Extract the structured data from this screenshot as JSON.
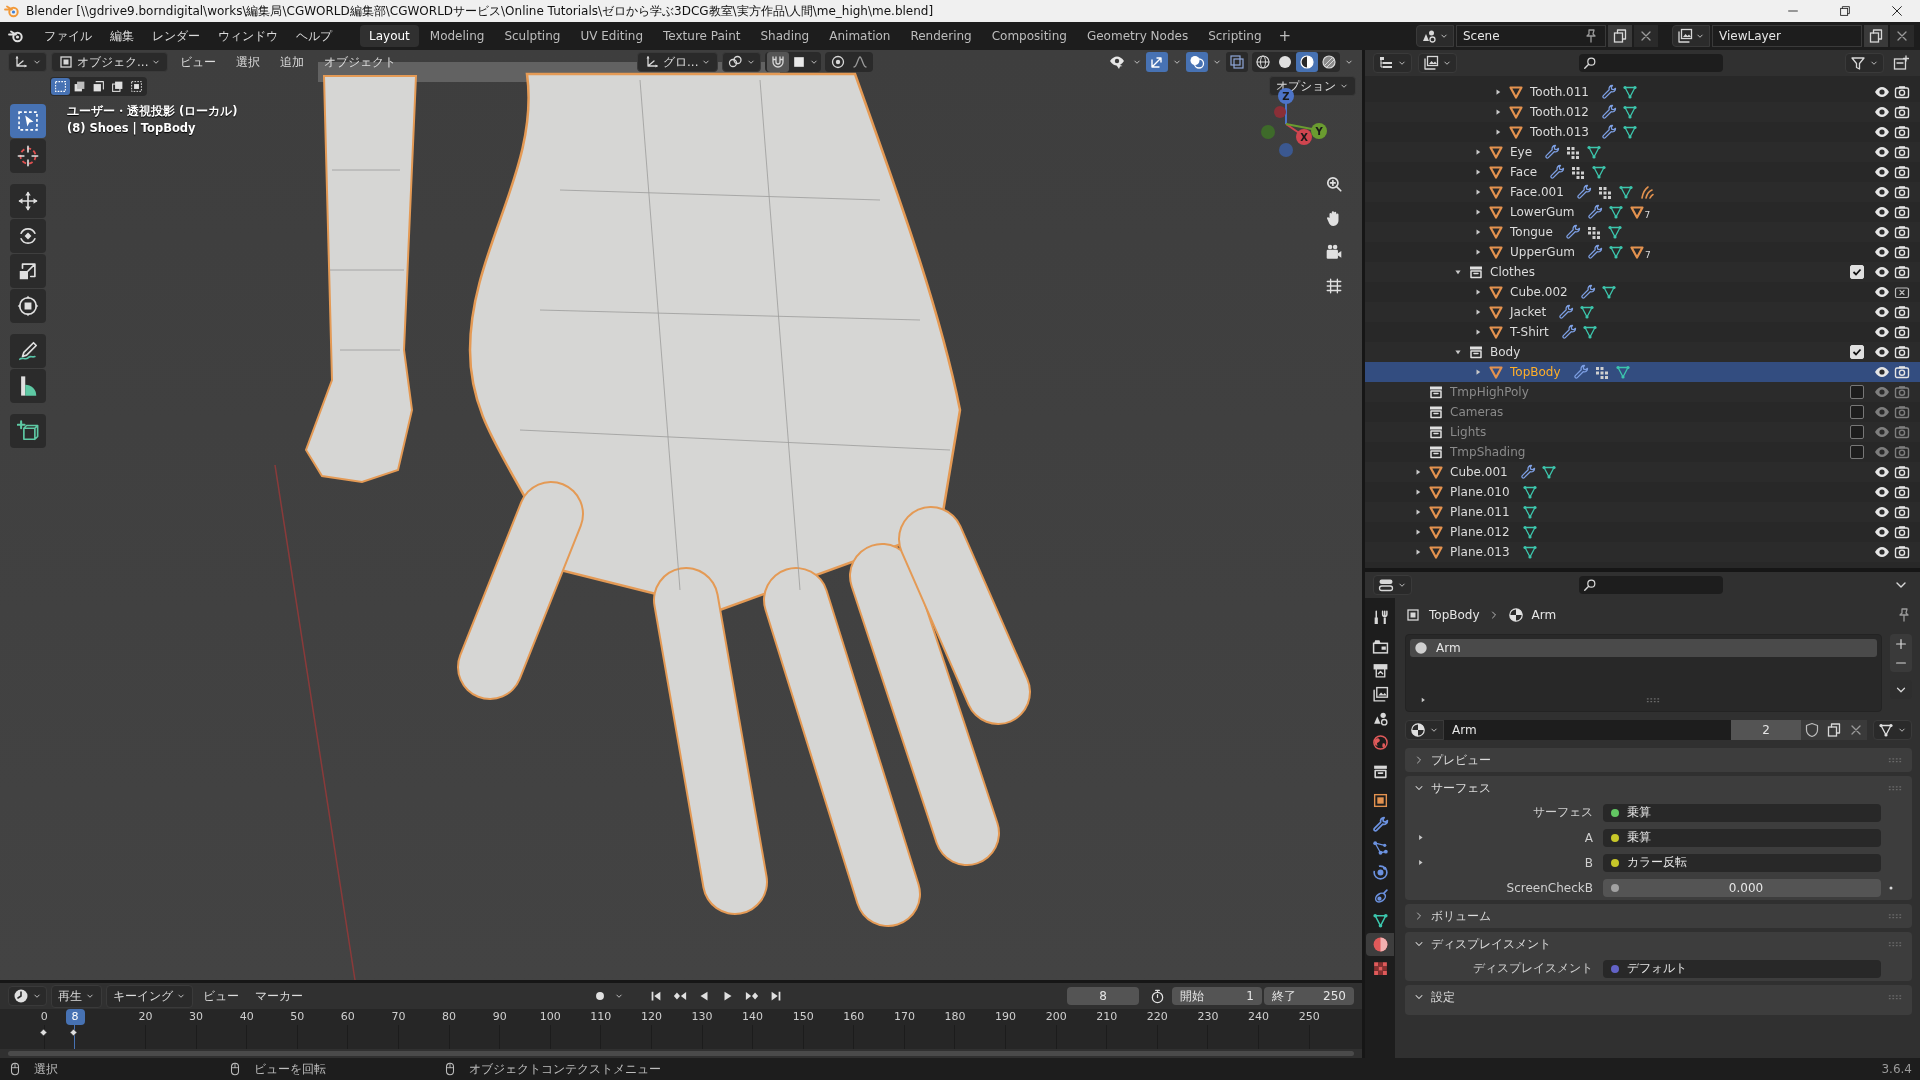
{
  "window": {
    "title": "Blender [\\\\gdrive9.borndigital\\works\\編集局\\CGWORLD編集部\\CGWORLDサービス\\Online Tutorials\\ゼロから学ぶ3DCG教室\\実方作品\\人間\\me_high\\me.blend]"
  },
  "menu": [
    "ファイル",
    "編集",
    "レンダー",
    "ウィンドウ",
    "ヘルプ"
  ],
  "workspaces": [
    {
      "label": "Layout",
      "selected": true
    },
    {
      "label": "Modeling",
      "selected": false
    },
    {
      "label": "Sculpting",
      "selected": false
    },
    {
      "label": "UV Editing",
      "selected": false
    },
    {
      "label": "Texture Paint",
      "selected": false
    },
    {
      "label": "Shading",
      "selected": false
    },
    {
      "label": "Animation",
      "selected": false
    },
    {
      "label": "Rendering",
      "selected": false
    },
    {
      "label": "Compositing",
      "selected": false
    },
    {
      "label": "Geometry Nodes",
      "selected": false
    },
    {
      "label": "Scripting",
      "selected": false
    }
  ],
  "add_workspace": "+",
  "scene": "Scene",
  "view_layer": "ViewLayer",
  "viewport": {
    "mode": "オブジェク...",
    "menus": [
      "ビュー",
      "選択",
      "追加",
      "オブジェクト"
    ],
    "orientation": "グロ...",
    "select_modes": [
      {
        "kind": "set",
        "selected": true
      },
      {
        "kind": "extend",
        "selected": false
      },
      {
        "kind": "subtract",
        "selected": false
      },
      {
        "kind": "invert",
        "selected": false
      },
      {
        "kind": "intersect",
        "selected": false
      }
    ],
    "shading": [
      {
        "kind": "wireframe",
        "selected": false
      },
      {
        "kind": "solid",
        "selected": false
      },
      {
        "kind": "material",
        "selected": true
      },
      {
        "kind": "rendered",
        "selected": false
      }
    ],
    "options": "オプション",
    "view_name": "ユーザー・透視投影 (ローカル)",
    "context": "(8) Shoes | TopBody",
    "tools": [
      {
        "kind": "select",
        "selected": true
      },
      {
        "kind": "cursor",
        "selected": false
      },
      {
        "kind": "move",
        "selected": false
      },
      {
        "kind": "rotate",
        "selected": false
      },
      {
        "kind": "scale",
        "selected": false
      },
      {
        "kind": "transform",
        "selected": false
      },
      {
        "kind": "annotate",
        "selected": false
      },
      {
        "kind": "measure",
        "selected": false
      },
      {
        "kind": "add_cube",
        "selected": false
      }
    ],
    "gizmo": {
      "z": "Z",
      "x": "X",
      "y": "Y"
    }
  },
  "outliner": {
    "tree": [
      {
        "children": [
          {
            "children": [
              {
                "children": [
                  {
                    "children": [
                      {
                        "name": "Tooth.011",
                        "kind": "object",
                        "expanded": false,
                        "selected": false,
                        "badges": [
                          {
                            "kind": "modifier"
                          },
                          {
                            "kind": "mesh"
                          }
                        ]
                      },
                      {
                        "name": "Tooth.012",
                        "kind": "object",
                        "expanded": false,
                        "selected": false,
                        "badges": [
                          {
                            "kind": "modifier"
                          },
                          {
                            "kind": "mesh"
                          }
                        ]
                      },
                      {
                        "name": "Tooth.013",
                        "kind": "object",
                        "expanded": false,
                        "selected": false,
                        "badges": [
                          {
                            "kind": "modifier"
                          },
                          {
                            "kind": "mesh"
                          }
                        ]
                      }
                    ]
                  },
                  {
                    "name": "Eye",
                    "kind": "object",
                    "expanded": false,
                    "selected": false,
                    "badges": [
                      {
                        "kind": "modifier"
                      },
                      {
                        "kind": "vertex_groups"
                      },
                      {
                        "kind": "mesh"
                      }
                    ]
                  },
                  {
                    "name": "Face",
                    "kind": "object",
                    "expanded": false,
                    "selected": false,
                    "badges": [
                      {
                        "kind": "modifier"
                      },
                      {
                        "kind": "vertex_groups"
                      },
                      {
                        "kind": "mesh"
                      }
                    ]
                  },
                  {
                    "name": "Face.001",
                    "kind": "object",
                    "expanded": false,
                    "selected": false,
                    "badges": [
                      {
                        "kind": "modifier"
                      },
                      {
                        "kind": "vertex_groups"
                      },
                      {
                        "kind": "mesh"
                      },
                      {
                        "kind": "hair"
                      }
                    ]
                  },
                  {
                    "name": "LowerGum",
                    "kind": "object",
                    "expanded": false,
                    "selected": false,
                    "badges": [
                      {
                        "kind": "modifier"
                      },
                      {
                        "kind": "mesh"
                      },
                      {
                        "kind": "material"
                      }
                    ],
                    "material_count": "7"
                  },
                  {
                    "name": "Tongue",
                    "kind": "object",
                    "expanded": false,
                    "selected": false,
                    "badges": [
                      {
                        "kind": "modifier"
                      },
                      {
                        "kind": "vertex_groups"
                      },
                      {
                        "kind": "mesh"
                      }
                    ]
                  },
                  {
                    "name": "UpperGum",
                    "kind": "object",
                    "expanded": false,
                    "selected": false,
                    "badges": [
                      {
                        "kind": "modifier"
                      },
                      {
                        "kind": "mesh"
                      },
                      {
                        "kind": "material"
                      }
                    ],
                    "material_count": "7"
                  }
                ]
              },
              {
                "name": "Clothes",
                "kind": "collection",
                "expanded": true,
                "checked": true,
                "selected": false,
                "children": [
                  {
                    "name": "Cube.002",
                    "kind": "object",
                    "expanded": false,
                    "selected": false,
                    "badges": [
                      {
                        "kind": "modifier"
                      },
                      {
                        "kind": "mesh"
                      }
                    ],
                    "render": false
                  },
                  {
                    "name": "Jacket",
                    "kind": "object",
                    "expanded": false,
                    "selected": false,
                    "badges": [
                      {
                        "kind": "modifier"
                      },
                      {
                        "kind": "mesh"
                      }
                    ]
                  },
                  {
                    "name": "T-Shirt",
                    "kind": "object",
                    "expanded": false,
                    "selected": false,
                    "badges": [
                      {
                        "kind": "modifier"
                      },
                      {
                        "kind": "mesh"
                      }
                    ]
                  }
                ]
              },
              {
                "name": "Body",
                "kind": "collection",
                "expanded": true,
                "checked": true,
                "selected": false,
                "children": [
                  {
                    "name": "TopBody",
                    "kind": "object",
                    "expanded": false,
                    "selected": true,
                    "badges": [
                      {
                        "kind": "modifier"
                      },
                      {
                        "kind": "vertex_groups"
                      },
                      {
                        "kind": "mesh"
                      }
                    ]
                  }
                ]
              }
            ]
          }
        ]
      },
      {
        "name": "TmpHighPoly",
        "kind": "collection",
        "checked": false,
        "selected": false
      },
      {
        "name": "Cameras",
        "kind": "collection",
        "checked": false,
        "selected": false
      },
      {
        "name": "Lights",
        "kind": "collection",
        "checked": false,
        "selected": false
      },
      {
        "name": "TmpShading",
        "kind": "collection",
        "checked": false,
        "selected": false
      },
      {
        "name": "Cube.001",
        "kind": "object",
        "expanded": false,
        "selected": false,
        "badges": [
          {
            "kind": "modifier"
          },
          {
            "kind": "mesh"
          }
        ]
      },
      {
        "name": "Plane.010",
        "kind": "object",
        "expanded": false,
        "selected": false,
        "badges": [
          {
            "kind": "mesh"
          }
        ]
      },
      {
        "name": "Plane.011",
        "kind": "object",
        "expanded": false,
        "selected": false,
        "badges": [
          {
            "kind": "mesh"
          }
        ]
      },
      {
        "name": "Plane.012",
        "kind": "object",
        "expanded": false,
        "selected": false,
        "badges": [
          {
            "kind": "mesh"
          }
        ]
      },
      {
        "name": "Plane.013",
        "kind": "object",
        "expanded": false,
        "selected": false,
        "badges": [
          {
            "kind": "mesh"
          }
        ]
      }
    ]
  },
  "properties": {
    "tabs": [
      {
        "kind": "tool",
        "selected": false
      },
      {
        "kind": "render",
        "selected": false
      },
      {
        "kind": "output",
        "selected": false
      },
      {
        "kind": "view_layer",
        "selected": false
      },
      {
        "kind": "scene",
        "selected": false
      },
      {
        "kind": "world",
        "selected": false
      },
      {
        "kind": "collection",
        "selected": false
      },
      {
        "kind": "object",
        "selected": false
      },
      {
        "kind": "modifiers",
        "selected": false
      },
      {
        "kind": "particles",
        "selected": false
      },
      {
        "kind": "physics",
        "selected": false
      },
      {
        "kind": "constraints",
        "selected": false
      },
      {
        "kind": "data",
        "selected": false
      },
      {
        "kind": "material",
        "selected": true
      },
      {
        "kind": "texture",
        "selected": false
      }
    ],
    "breadcrumb": {
      "object": "TopBody",
      "material": "Arm"
    },
    "slots": [
      {
        "name": "Arm",
        "selected": true
      }
    ],
    "material": {
      "name": "Arm",
      "users": "2"
    },
    "panels": [
      {
        "title": "プレビュー",
        "expanded": false
      },
      {
        "title": "サーフェス",
        "expanded": true,
        "fields": [
          {
            "label": "サーフェス",
            "kind": "socket",
            "value": "乗算",
            "color": "#63c763"
          },
          {
            "label": "A",
            "kind": "socket",
            "value": "乗算",
            "color": "#c7c729",
            "expander": true
          },
          {
            "label": "B",
            "kind": "socket",
            "value": "カラー反転",
            "color": "#c7c729",
            "expander": true
          },
          {
            "label": "ScreenCheckB",
            "kind": "number",
            "value": "0.000",
            "color": "#a1a1a1"
          }
        ]
      },
      {
        "title": "ボリューム",
        "expanded": false
      },
      {
        "title": "ディスプレイスメント",
        "expanded": true,
        "fields": [
          {
            "label": "ディスプレイスメント",
            "kind": "socket",
            "value": "デフォルト",
            "color": "#6363c7"
          }
        ]
      },
      {
        "title": "設定",
        "expanded": true
      }
    ]
  },
  "timeline": {
    "menus": [
      {
        "label": "再生",
        "dropdown": true
      },
      {
        "label": "キーイング",
        "dropdown": true
      },
      {
        "label": "ビュー",
        "dropdown": false
      },
      {
        "label": "マーカー",
        "dropdown": false
      }
    ],
    "current_frame": "8",
    "start_label": "開始",
    "start": "1",
    "end_label": "終了",
    "end": "250",
    "playhead": "8",
    "ticks": [
      "0",
      "20",
      "30",
      "40",
      "50",
      "60",
      "70",
      "80",
      "90",
      "100",
      "110",
      "120",
      "130",
      "140",
      "150",
      "160",
      "170",
      "180",
      "190",
      "200",
      "210",
      "220",
      "230",
      "240",
      "250"
    ]
  },
  "status_bar": {
    "hints": [
      "選択",
      "ビューを回転",
      "オブジェクトコンテクストメニュー"
    ],
    "version": "3.6.4"
  }
}
